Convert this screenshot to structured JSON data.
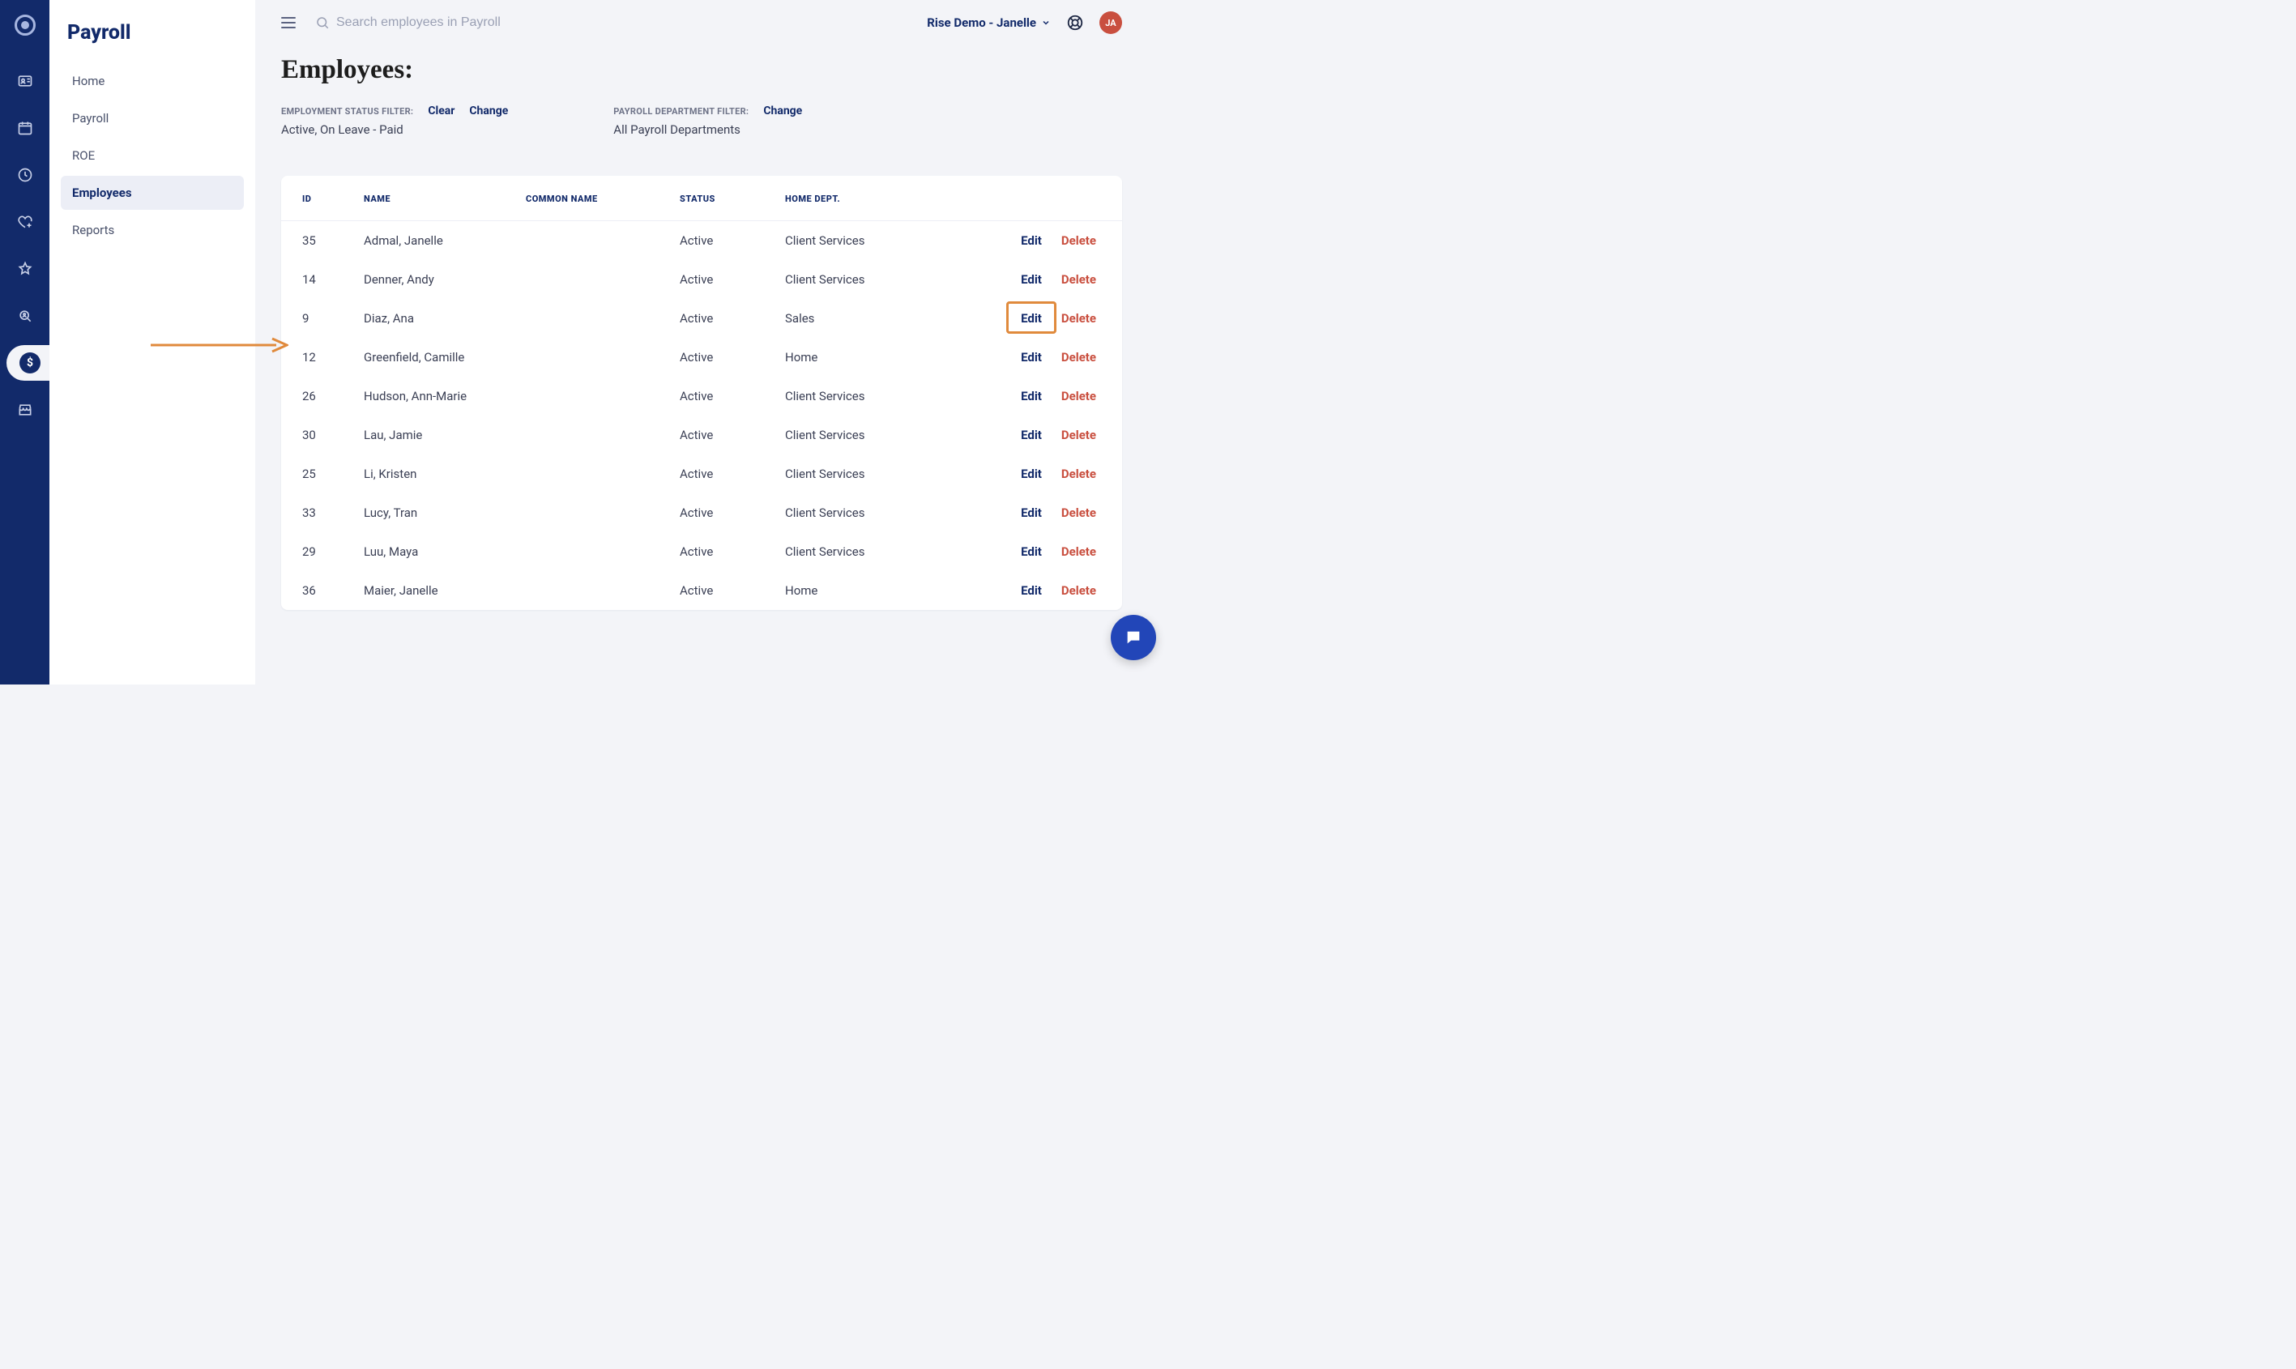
{
  "sidebar": {
    "title": "Payroll",
    "items": [
      {
        "label": "Home"
      },
      {
        "label": "Payroll"
      },
      {
        "label": "ROE"
      },
      {
        "label": "Employees"
      },
      {
        "label": "Reports"
      }
    ],
    "selected_index": 3
  },
  "rail": {
    "active_index": 6,
    "icons": [
      "logo",
      "id-card",
      "calendar",
      "clock",
      "heart-plus",
      "star",
      "person-search",
      "dollar",
      "shop"
    ]
  },
  "topbar": {
    "search_placeholder": "Search employees in Payroll",
    "account_label": "Rise Demo - Janelle",
    "avatar_initials": "JA"
  },
  "page": {
    "title": "Employees:"
  },
  "filters": {
    "employment": {
      "label": "EMPLOYMENT STATUS FILTER:",
      "clear_label": "Clear",
      "change_label": "Change",
      "value": "Active, On Leave - Paid"
    },
    "department": {
      "label": "PAYROLL DEPARTMENT FILTER:",
      "change_label": "Change",
      "value": "All Payroll Departments"
    }
  },
  "table": {
    "headers": {
      "id": "ID",
      "name": "NAME",
      "common_name": "COMMON NAME",
      "status": "STATUS",
      "home_dept": "HOME DEPT."
    },
    "edit_label": "Edit",
    "delete_label": "Delete",
    "highlighted_row_index": 2,
    "rows": [
      {
        "id": "35",
        "name": "Admal, Janelle",
        "common_name": "",
        "status": "Active",
        "home_dept": "Client Services"
      },
      {
        "id": "14",
        "name": "Denner, Andy",
        "common_name": "",
        "status": "Active",
        "home_dept": "Client Services"
      },
      {
        "id": "9",
        "name": "Diaz, Ana",
        "common_name": "",
        "status": "Active",
        "home_dept": "Sales"
      },
      {
        "id": "12",
        "name": "Greenfield, Camille",
        "common_name": "",
        "status": "Active",
        "home_dept": "Home"
      },
      {
        "id": "26",
        "name": "Hudson, Ann-Marie",
        "common_name": "",
        "status": "Active",
        "home_dept": "Client Services"
      },
      {
        "id": "30",
        "name": "Lau, Jamie",
        "common_name": "",
        "status": "Active",
        "home_dept": "Client Services"
      },
      {
        "id": "25",
        "name": "Li, Kristen",
        "common_name": "",
        "status": "Active",
        "home_dept": "Client Services"
      },
      {
        "id": "33",
        "name": "Lucy, Tran",
        "common_name": "",
        "status": "Active",
        "home_dept": "Client Services"
      },
      {
        "id": "29",
        "name": "Luu, Maya",
        "common_name": "",
        "status": "Active",
        "home_dept": "Client Services"
      },
      {
        "id": "36",
        "name": "Maier, Janelle",
        "common_name": "",
        "status": "Active",
        "home_dept": "Home"
      }
    ]
  }
}
